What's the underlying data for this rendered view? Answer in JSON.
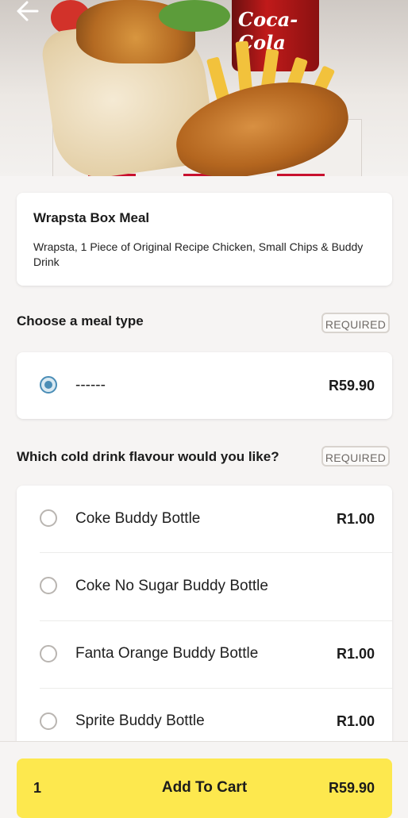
{
  "hero": {
    "image_alt": "Wrapsta Box Meal with chicken wrap, fried chicken piece, chips and Coca-Cola",
    "bottle_text": "Coca-Cola",
    "back_icon": "arrow-left-icon"
  },
  "product": {
    "title": "Wrapsta Box Meal",
    "description": "Wrapsta, 1 Piece of Original Recipe Chicken, Small Chips & Buddy Drink"
  },
  "meal_type": {
    "title": "Choose a meal type",
    "badge": "REQUIRED",
    "options": [
      {
        "label": "------",
        "price": "R59.90",
        "selected": true
      }
    ]
  },
  "drink": {
    "title": "Which cold drink flavour would you like?",
    "badge": "REQUIRED",
    "options": [
      {
        "label": "Coke Buddy Bottle",
        "price": "R1.00",
        "selected": false
      },
      {
        "label": "Coke No Sugar Buddy Bottle",
        "price": "",
        "selected": false
      },
      {
        "label": "Fanta Orange Buddy Bottle",
        "price": "R1.00",
        "selected": false
      },
      {
        "label": "Sprite Buddy Bottle",
        "price": "R1.00",
        "selected": false
      }
    ]
  },
  "cart": {
    "quantity": "1",
    "label": "Add To Cart",
    "total": "R59.90"
  },
  "colors": {
    "accent_yellow": "#fde84e",
    "radio_selected": "#4a8db6",
    "background": "#f6f4f3"
  }
}
